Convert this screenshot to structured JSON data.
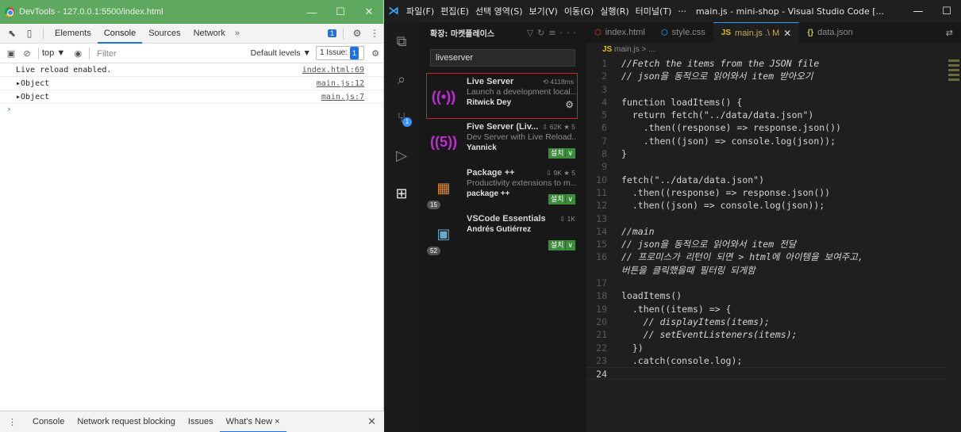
{
  "devtools": {
    "window_title": "DevTools - 127.0.0.1:5500/index.html",
    "tabs": [
      "Elements",
      "Console",
      "Sources",
      "Network"
    ],
    "active_tab": "Console",
    "more": "»",
    "badge_count": "1",
    "toolbar": {
      "context": "top ▼",
      "filter_placeholder": "Filter",
      "levels": "Default levels ▼",
      "issue_label": "1 Issue:",
      "issue_count": "1"
    },
    "console_lines": [
      {
        "msg": "Live reload enabled.",
        "src": "index.html:69"
      },
      {
        "msg": "▸Object",
        "src": "main.js:12"
      },
      {
        "msg": "▸Object",
        "src": "main.js:7"
      }
    ],
    "prompt": "›",
    "drawer_tabs": [
      "Console",
      "Network request blocking",
      "Issues",
      "What's New ×"
    ],
    "drawer_active": "What's New ×"
  },
  "vscode": {
    "menu": [
      "파일(F)",
      "편집(E)",
      "선택 영역(S)",
      "보기(V)",
      "이동(G)",
      "실행(R)",
      "터미널(T)",
      "···"
    ],
    "window_title": "main.js - mini-shop - Visual Studio Code [...",
    "sidebar_title": "확장: 마켓플레이스",
    "search_value": "liveserver",
    "extensions": [
      {
        "name": "Live Server",
        "desc": "Launch a development local...",
        "author": "Ritwick Dey",
        "stat": "4118ms",
        "count": "",
        "action": "gear"
      },
      {
        "name": "Five Server (Liv...",
        "desc": "Dev Server with Live Reload...",
        "author": "Yannick",
        "stat": "62K ★ 5",
        "count": "",
        "action": "설치"
      },
      {
        "name": "Package ++",
        "desc": "Productivity extensions to m...",
        "author": "package ++",
        "stat": "9K ★ 5",
        "count": "15",
        "action": "설치"
      },
      {
        "name": "VSCode Essentials",
        "desc": "",
        "author": "Andrés Gutiérrez",
        "stat": "1K",
        "count": "52",
        "action": "설치"
      }
    ],
    "editor_tabs": [
      {
        "label": "index.html",
        "active": false
      },
      {
        "label": "style.css",
        "active": false
      },
      {
        "label": "main.js .\\ M",
        "active": true
      },
      {
        "label": "data.json",
        "active": false
      }
    ],
    "breadcrumb": "main.js > ...",
    "line_numbers": [
      "1",
      "2",
      "3",
      "4",
      "5",
      "6",
      "7",
      "8",
      "9",
      "10",
      "11",
      "12",
      "13",
      "14",
      "15",
      "16",
      "",
      "17",
      "18",
      "19",
      "20",
      "21",
      "22",
      "23",
      "24"
    ],
    "code_lines": [
      "//Fetch the items from the JSON file",
      "// json을 동적으로 읽어와서 item 받아오기",
      "",
      "function loadItems() {",
      "  return fetch(\"../data/data.json\")",
      "    .then((response) => response.json())",
      "    .then((json) => console.log(json));",
      "}",
      "",
      "fetch(\"../data/data.json\")",
      "  .then((response) => response.json())",
      "  .then((json) => console.log(json));",
      "",
      "//main",
      "// json을 동적으로 읽어와서 item 전달",
      "// 프로미스가 리턴이 되면 > html에 아이템을 보여주고,",
      "버튼을 클릭했을때 필터링 되게함",
      "",
      "loadItems()",
      "  .then((items) => {",
      "    // displayItems(items);",
      "    // setEventListeners(items);",
      "  })",
      "  .catch(console.log);",
      ""
    ]
  }
}
